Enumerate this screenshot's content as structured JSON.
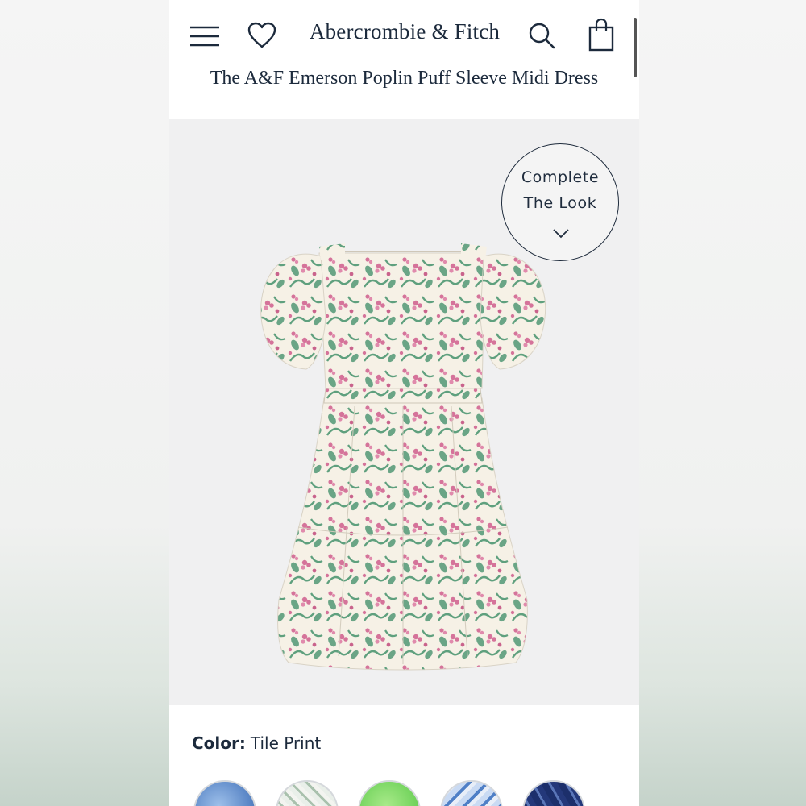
{
  "header": {
    "brand": "Abercrombie & Fitch",
    "menu_icon": "hamburger-menu-icon",
    "wishlist_icon": "heart-icon",
    "search_icon": "search-icon",
    "bag_icon": "shopping-bag-icon"
  },
  "product": {
    "title": "The A&F Emerson Poplin Puff Sleeve Midi Dress",
    "image_icon": "floral-dress-image"
  },
  "complete_the_look": {
    "line1": "Complete",
    "line2": "The Look",
    "icon": "chevron-down-icon"
  },
  "color": {
    "label": "Color:",
    "value": "Tile Print",
    "swatches": [
      "blue",
      "white-green-print",
      "green",
      "blue-white-print",
      "navy-print"
    ]
  },
  "colors": {
    "text_primary": "#1c2a3c",
    "image_background": "#f0f0f1",
    "dress_pink": "#d5739a",
    "dress_green": "#5fa07e",
    "dress_cream": "#f6f1e6"
  }
}
